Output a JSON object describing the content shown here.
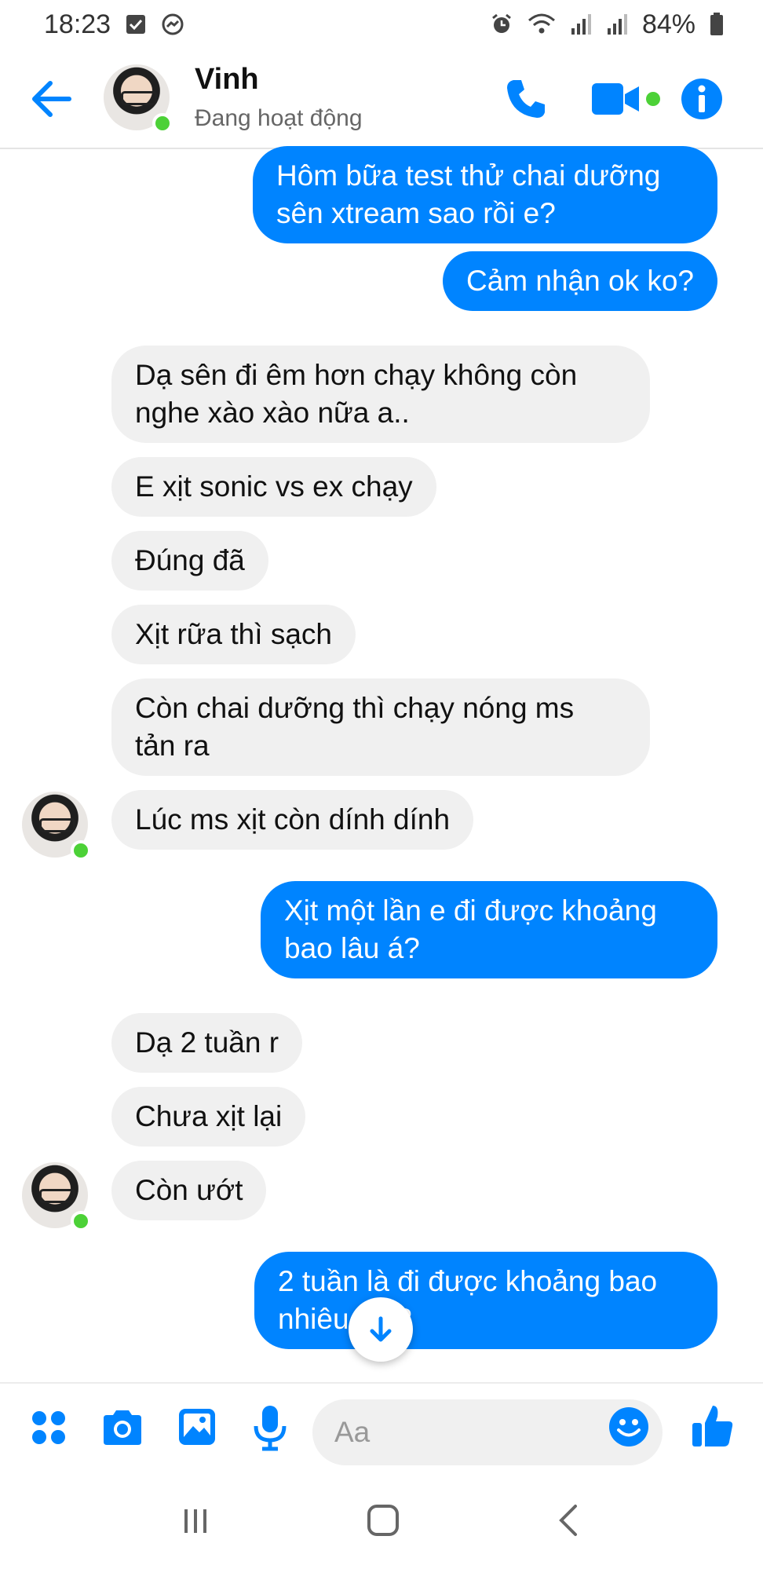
{
  "status_bar": {
    "time": "18:23",
    "battery": "84%"
  },
  "header": {
    "contact_name": "Vinh",
    "presence": "Đang hoạt động"
  },
  "messages": [
    {
      "id": 1,
      "direction": "outgoing",
      "text": "Hôm bữa test thử chai dưỡng\nsên xtream sao rồi e?"
    },
    {
      "id": 2,
      "direction": "outgoing",
      "text": "Cảm nhận ok ko?"
    },
    {
      "id": 3,
      "direction": "incoming",
      "text": "Dạ sên đi êm hơn chạy không còn\nnghe xào xào nữa a.."
    },
    {
      "id": 4,
      "direction": "incoming",
      "text": "E xịt sonic vs ex chạy"
    },
    {
      "id": 5,
      "direction": "incoming",
      "text": "Đúng đã"
    },
    {
      "id": 6,
      "direction": "incoming",
      "text": "Xịt rữa thì sạch"
    },
    {
      "id": 7,
      "direction": "incoming",
      "text": "Còn chai dưỡng thì chạy nóng ms\ntản ra"
    },
    {
      "id": 8,
      "direction": "incoming",
      "text": "Lúc ms xịt còn dính dính"
    },
    {
      "id": 9,
      "direction": "outgoing",
      "text": "Xịt một lần e đi được khoảng\nbao lâu á?"
    },
    {
      "id": 10,
      "direction": "incoming",
      "text": "Dạ 2 tuần r"
    },
    {
      "id": 11,
      "direction": "incoming",
      "text": "Chưa xịt lại"
    },
    {
      "id": 12,
      "direction": "incoming",
      "text": "Còn ướt"
    },
    {
      "id": 13,
      "direction": "outgoing",
      "text": "2 tuần là đi được khoảng bao\nnhiêu km?"
    }
  ],
  "composer": {
    "placeholder": "Aa"
  },
  "colors": {
    "accent": "#0084ff",
    "incoming_bubble": "#f0f0f0",
    "online": "#4cd137"
  },
  "icons": {
    "header": [
      "back-arrow-icon",
      "phone-icon",
      "video-camera-icon",
      "info-icon"
    ],
    "composer": [
      "apps-grid-icon",
      "camera-icon",
      "gallery-icon",
      "microphone-icon",
      "emoji-icon",
      "thumbs-up-icon"
    ],
    "navigation": [
      "recent-apps-icon",
      "home-icon",
      "back-chevron-icon"
    ]
  }
}
